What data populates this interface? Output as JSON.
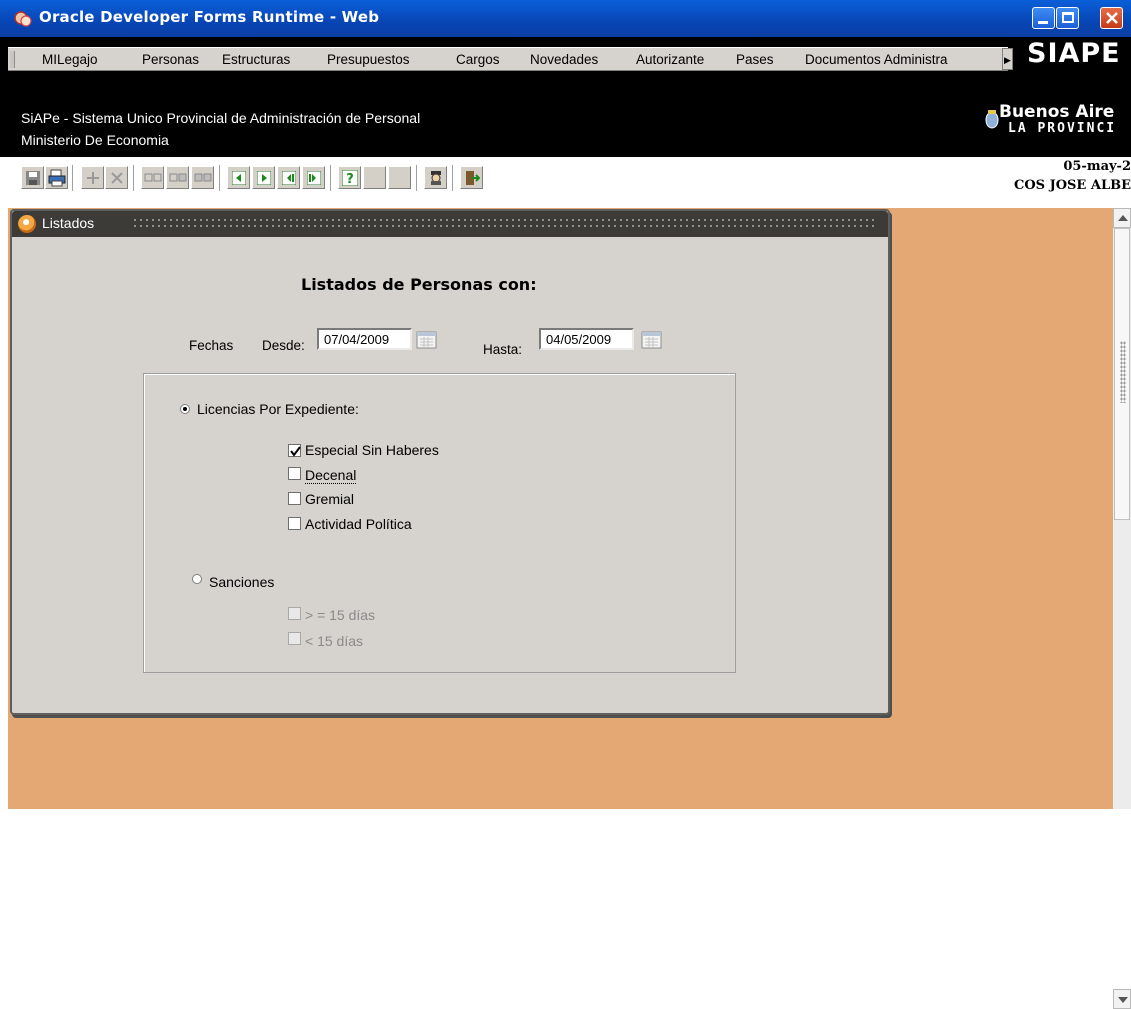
{
  "window": {
    "title": "Oracle Developer Forms Runtime - Web"
  },
  "menu": {
    "items": [
      {
        "label": "MILegajo"
      },
      {
        "label": "Personas"
      },
      {
        "label": "Estructuras"
      },
      {
        "label": "Presupuestos"
      },
      {
        "label": "Cargos"
      },
      {
        "label": "Novedades"
      },
      {
        "label": "Autorizante"
      },
      {
        "label": "Pases"
      },
      {
        "label": "Documentos Administra"
      }
    ],
    "brand": "SIAPE"
  },
  "header": {
    "line1": "SiAPe - Sistema Unico Provincial de Administración de Personal",
    "line2": "Ministerio De Economia",
    "logo_name": "Buenos Aire",
    "logo_sub": "LA PROVINCI"
  },
  "toolbar": {
    "date": "05-may-2",
    "user": "COS JOSE ALBE",
    "icons": [
      "save-icon",
      "print-icon",
      "insert-record-icon",
      "delete-record-icon",
      "block-icon",
      "block-icon",
      "block-icon",
      "prev-record-icon",
      "next-record-icon",
      "prev-block-icon",
      "next-block-icon",
      "help-icon",
      "query-icon",
      "exit-icon"
    ]
  },
  "form": {
    "window_title": "Listados",
    "heading": "Listados de Personas con:",
    "fechas_label": "Fechas",
    "desde_label": "Desde:",
    "desde_value": "07/04/2009",
    "hasta_label": "Hasta:",
    "hasta_value": "04/05/2009",
    "licencias": {
      "label": "Licencias Por Expediente:",
      "selected": true,
      "options": [
        {
          "label": "Especial Sin Haberes",
          "checked": true
        },
        {
          "label": "Decenal",
          "checked": false
        },
        {
          "label": "Gremial",
          "checked": false
        },
        {
          "label": "Actividad Política",
          "checked": false
        }
      ]
    },
    "sanciones": {
      "label": "Sanciones",
      "selected": false,
      "options": [
        {
          "label": "> = 15 días",
          "checked": false,
          "disabled": true
        },
        {
          "label": "< 15 días",
          "checked": false,
          "disabled": true
        }
      ]
    }
  },
  "colors": {
    "workspace": "#e3a873",
    "form_bg": "#d6d3ce",
    "titlebar": "#0845b5"
  }
}
